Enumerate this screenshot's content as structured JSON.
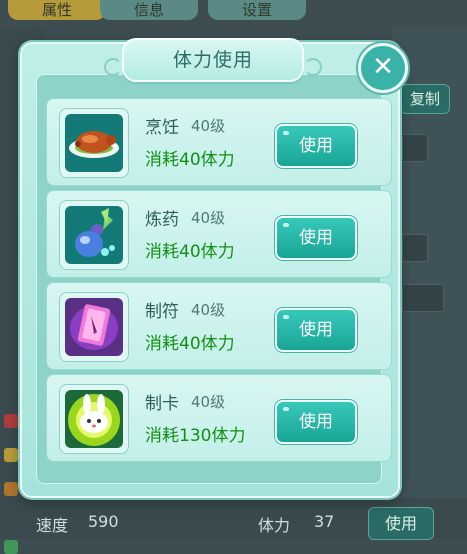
{
  "background": {
    "tabs": [
      "属性",
      "信息",
      "设置"
    ],
    "copy_label": "复制",
    "stats": [
      {
        "label": "速度",
        "value": "590"
      },
      {
        "label": "体力",
        "value": "37"
      }
    ],
    "use_label": "使用"
  },
  "dialog": {
    "title": "体力使用",
    "close_icon": "close-x-icon",
    "items": [
      {
        "name": "烹饪",
        "level": "40级",
        "cost": "消耗40体力",
        "button": "使用",
        "icon": "roast-pig-icon"
      },
      {
        "name": "炼药",
        "level": "40级",
        "cost": "消耗40体力",
        "button": "使用",
        "icon": "potion-gourd-icon"
      },
      {
        "name": "制符",
        "level": "40级",
        "cost": "消耗40体力",
        "button": "使用",
        "icon": "talisman-card-icon"
      },
      {
        "name": "制卡",
        "level": "40级",
        "cost": "消耗130体力",
        "button": "使用",
        "icon": "rabbit-card-icon"
      }
    ]
  },
  "colors": {
    "cost_text": "#129014",
    "button": "#18a596",
    "dialog_bg": "#a6e3dc"
  }
}
